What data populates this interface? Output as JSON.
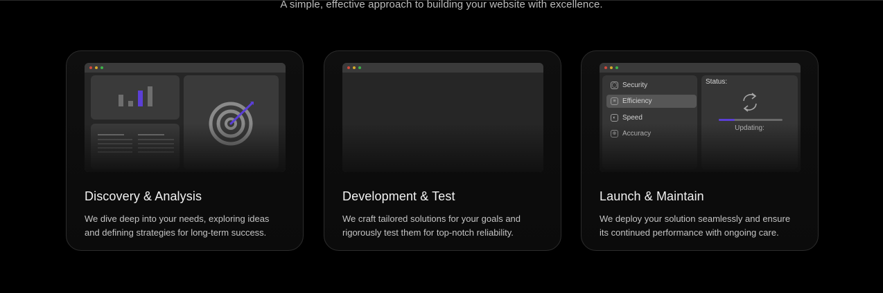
{
  "header": {
    "subtitle": "A simple, effective approach to building your website with excellence."
  },
  "cards": [
    {
      "title": "Discovery & Analysis",
      "line1": "We dive deep into your needs, exploring ideas",
      "line2": "and defining strategies for long-term success.",
      "chart_bars": [
        0.55,
        0.25,
        0.75,
        0.95
      ]
    },
    {
      "title": "Development & Test",
      "line1": "We craft tailored solutions for your goals and",
      "line2": "rigorously test them for top-notch reliability."
    },
    {
      "title": "Launch & Maintain",
      "line1": "We deploy your solution seamlessly and ensure",
      "line2": "its continued performance with ongoing care.",
      "menu": [
        "Security",
        "Efficiency",
        "Speed",
        "Accuracy"
      ],
      "menu_icons": [
        "shield-icon",
        "checklist-icon",
        "gauge-icon",
        "crosshair-icon"
      ],
      "active_item": "Efficiency",
      "status_label": "Status:",
      "updating_label": "Updating:",
      "progress": 0.25
    }
  ],
  "colors": {
    "accent": "#5b3fd6",
    "background": "#000000",
    "card": "#0f0f0f"
  }
}
